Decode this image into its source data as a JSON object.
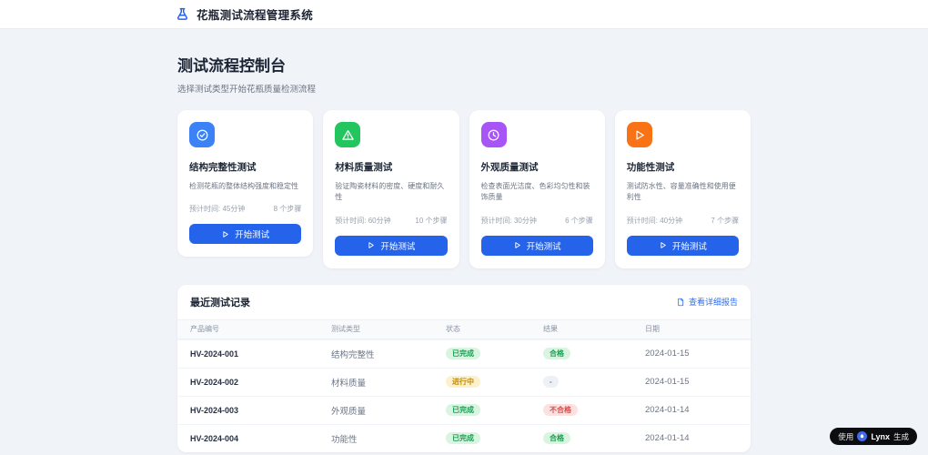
{
  "app": {
    "title": "花瓶测试流程管理系统"
  },
  "page": {
    "title": "测试流程控制台",
    "subtitle": "选择测试类型开始花瓶质量检测流程"
  },
  "colors": {
    "primary": "#2563eb",
    "card_icon_blue": "#3b82f6",
    "card_icon_green": "#22c55e",
    "card_icon_purple": "#a855f7",
    "card_icon_orange": "#f97316"
  },
  "cards": [
    {
      "icon": "circle-check-icon",
      "color": "#3b82f6",
      "title": "结构完整性测试",
      "description": "检测花瓶的整体结构强度和稳定性",
      "time_label": "预计时间: 45分钟",
      "steps_label": "8 个步骤",
      "button_label": "开始测试"
    },
    {
      "icon": "warning-triangle-icon",
      "color": "#22c55e",
      "title": "材料质量测试",
      "description": "验证陶瓷材料的密度、硬度和耐久性",
      "time_label": "预计时间: 60分钟",
      "steps_label": "10 个步骤",
      "button_label": "开始测试"
    },
    {
      "icon": "clock-icon",
      "color": "#a855f7",
      "title": "外观质量测试",
      "description": "检查表面光洁度、色彩均匀性和装饰质量",
      "time_label": "预计时间: 30分钟",
      "steps_label": "6 个步骤",
      "button_label": "开始测试"
    },
    {
      "icon": "play-icon",
      "color": "#f97316",
      "title": "功能性测试",
      "description": "测试防水性、容量准确性和使用便利性",
      "time_label": "预计时间: 40分钟",
      "steps_label": "7 个步骤",
      "button_label": "开始测试"
    }
  ],
  "records": {
    "title": "最近测试记录",
    "report_link": "查看详细报告",
    "columns": [
      "产品编号",
      "测试类型",
      "状态",
      "结果",
      "日期"
    ],
    "rows": [
      {
        "id": "HV-2024-001",
        "type": "结构完整性",
        "status": "已完成",
        "status_kind": "green",
        "result": "合格",
        "result_kind": "green",
        "date": "2024-01-15"
      },
      {
        "id": "HV-2024-002",
        "type": "材料质量",
        "status": "进行中",
        "status_kind": "yellow",
        "result": "-",
        "result_kind": "gray",
        "date": "2024-01-15"
      },
      {
        "id": "HV-2024-003",
        "type": "外观质量",
        "status": "已完成",
        "status_kind": "green",
        "result": "不合格",
        "result_kind": "red",
        "date": "2024-01-14"
      },
      {
        "id": "HV-2024-004",
        "type": "功能性",
        "status": "已完成",
        "status_kind": "green",
        "result": "合格",
        "result_kind": "green",
        "date": "2024-01-14"
      }
    ]
  },
  "gen_badge": {
    "prefix": "使用",
    "brand": "Lynx",
    "suffix": "生成"
  }
}
